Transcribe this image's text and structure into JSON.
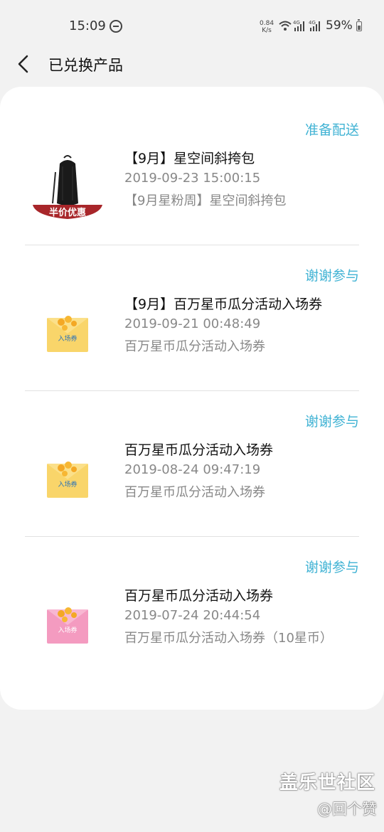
{
  "status_bar": {
    "time": "15:09",
    "net_speed_value": "0.84",
    "net_speed_unit": "K/s",
    "network_1": "4G",
    "network_2": "4G",
    "battery": "59%"
  },
  "header": {
    "back_icon": "chevron-left-icon",
    "title": "已兑换产品"
  },
  "items": [
    {
      "status": "准备配送",
      "name": "【9月】星空间斜挎包",
      "date": "2019-09-23 15:00:15",
      "description": "【9月星粉周】星空间斜挎包",
      "thumb_label": "半价优惠",
      "thumb_type": "bag"
    },
    {
      "status": "谢谢参与",
      "name": "【9月】百万星币瓜分活动入场券",
      "date": "2019-09-21 00:48:49",
      "description": "百万星币瓜分活动入场券",
      "thumb_label": "入场券",
      "thumb_type": "ticket-yellow"
    },
    {
      "status": "谢谢参与",
      "name": "百万星币瓜分活动入场券",
      "date": "2019-08-24 09:47:19",
      "description": "百万星币瓜分活动入场券",
      "thumb_label": "入场券",
      "thumb_type": "ticket-yellow"
    },
    {
      "status": "谢谢参与",
      "name": "百万星币瓜分活动入场券",
      "date": "2019-07-24 20:44:54",
      "description": "百万星币瓜分活动入场券（10星币）",
      "thumb_label": "入场券",
      "thumb_type": "ticket-pink"
    }
  ],
  "watermark": {
    "title": "盖乐世社区",
    "user": "@回个赞"
  },
  "colors": {
    "status_accent": "#41b3d4",
    "background": "#f2f2f2",
    "card": "#ffffff",
    "badge_red": "#a8262a"
  }
}
